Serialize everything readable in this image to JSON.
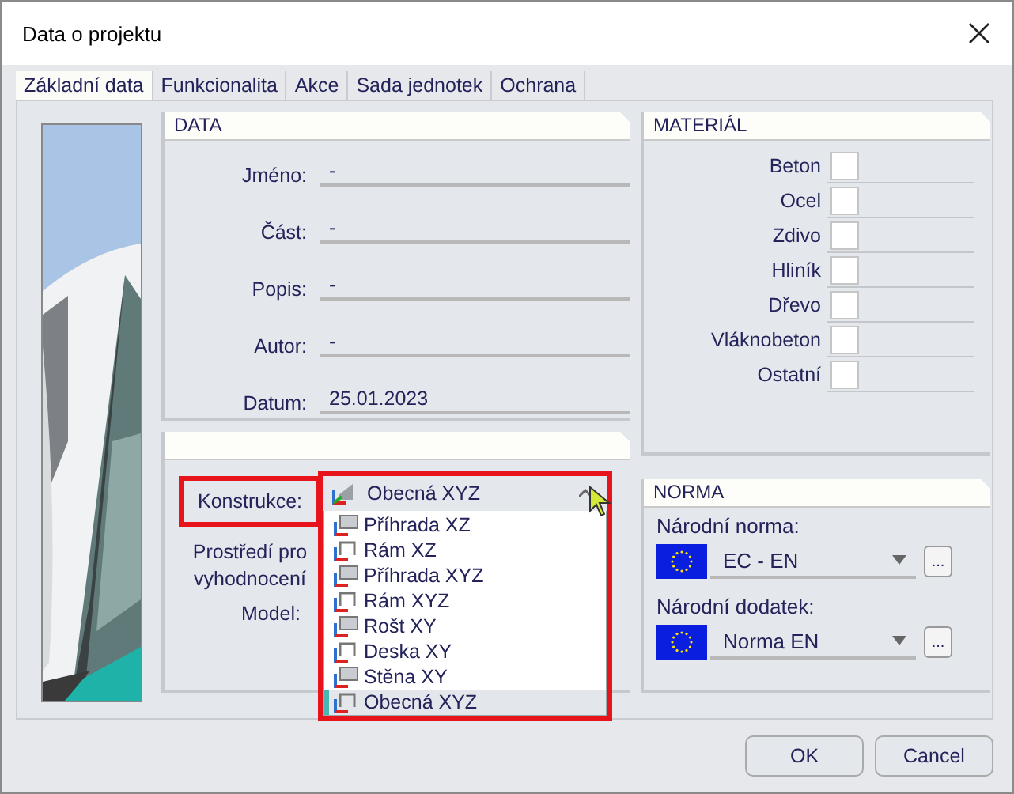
{
  "window": {
    "title": "Data o projektu"
  },
  "tabs": [
    {
      "label": "Základní data",
      "selected": true
    },
    {
      "label": "Funkcionalita",
      "selected": false
    },
    {
      "label": "Akce",
      "selected": false
    },
    {
      "label": "Sada jednotek",
      "selected": false
    },
    {
      "label": "Ochrana",
      "selected": false
    }
  ],
  "data_panel": {
    "title": "DATA",
    "fields": [
      {
        "label": "Jméno:",
        "value": "-"
      },
      {
        "label": "Část:",
        "value": "-"
      },
      {
        "label": "Popis:",
        "value": "-"
      },
      {
        "label": "Autor:",
        "value": "-"
      },
      {
        "label": "Datum:",
        "value": "25.01.2023"
      }
    ]
  },
  "material_panel": {
    "title": "MATERIÁL",
    "items": [
      {
        "label": "Beton",
        "checked": false
      },
      {
        "label": "Ocel",
        "checked": false
      },
      {
        "label": "Zdivo",
        "checked": false
      },
      {
        "label": "Hliník",
        "checked": false
      },
      {
        "label": "Dřevo",
        "checked": false
      },
      {
        "label": "Vláknobeton",
        "checked": false
      },
      {
        "label": "Ostatní",
        "checked": false
      }
    ]
  },
  "structure_panel": {
    "construction_label": {
      "text": "Konstrukce:",
      "highlighted": true
    },
    "construction_dropdown": {
      "value": "Obecná XYZ",
      "expanded": true,
      "highlighted": true,
      "options": [
        {
          "label": "Příhrada XZ",
          "selected": false
        },
        {
          "label": "Rám XZ",
          "selected": false
        },
        {
          "label": "Příhrada XYZ",
          "selected": false
        },
        {
          "label": "Rám XYZ",
          "selected": false
        },
        {
          "label": "Rošt XY",
          "selected": false
        },
        {
          "label": "Deska XY",
          "selected": false
        },
        {
          "label": "Stěna XY",
          "selected": false
        },
        {
          "label": "Obecná XYZ",
          "selected": true
        }
      ]
    },
    "environment_label": "Prostředí pro vyhodnocení",
    "model_label": "Model:"
  },
  "norma_panel": {
    "title": "NORMA",
    "rows": [
      {
        "label": "Národní norma:",
        "value": "EC - EN",
        "more": "..."
      },
      {
        "label": "Národní dodatek:",
        "value": "Norma EN",
        "more": "..."
      }
    ]
  },
  "buttons": [
    "OK",
    "Cancel"
  ]
}
